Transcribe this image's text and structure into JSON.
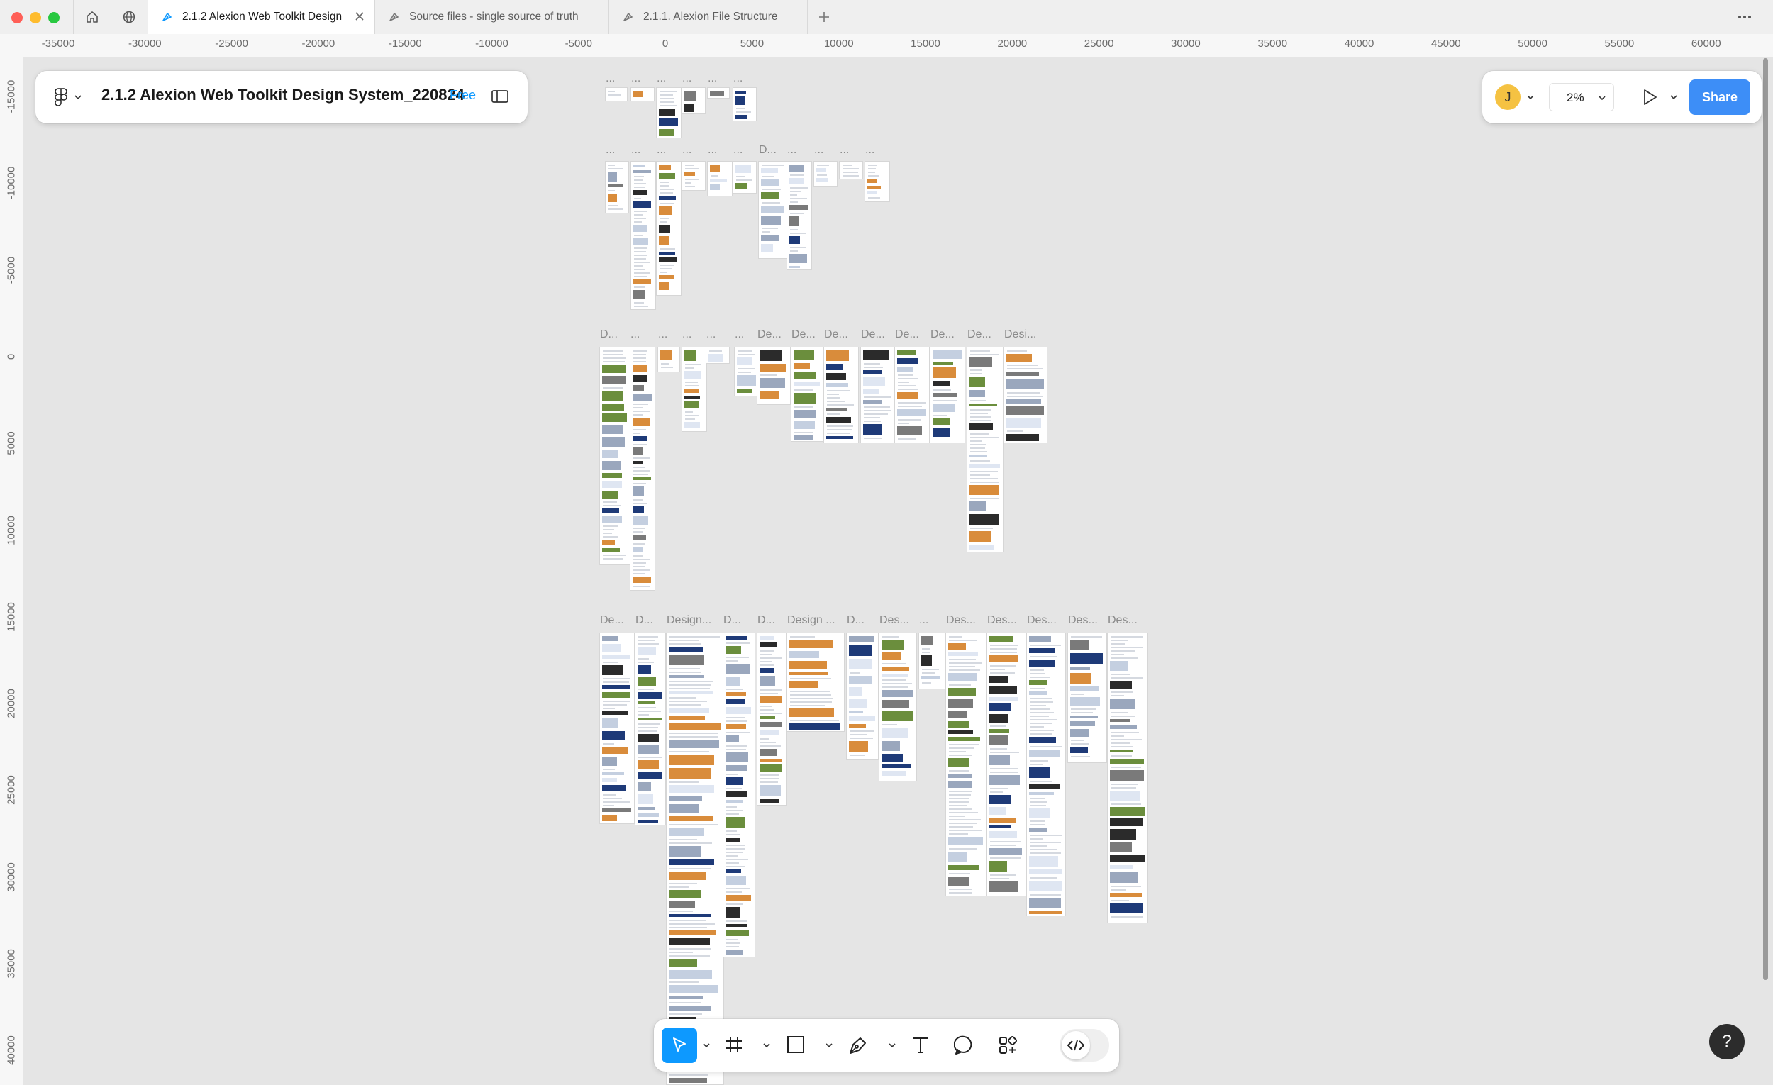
{
  "window": {
    "traffic_lights": [
      "#ff5f57",
      "#febc2e",
      "#28c840"
    ]
  },
  "tabs": [
    {
      "label": "2.1.2 Alexion Web Toolkit Design System_220824",
      "icon": "design-file-icon",
      "active": true
    },
    {
      "label": "Source files - single source of truth",
      "icon": "design-file-icon",
      "active": false
    },
    {
      "label": "2.1.1. Alexion File Structure",
      "icon": "design-file-icon",
      "active": false
    }
  ],
  "rulers": {
    "horizontal": [
      "-35000",
      "-30000",
      "-25000",
      "-20000",
      "-15000",
      "-10000",
      "-5000",
      "0",
      "5000",
      "10000",
      "15000",
      "20000",
      "25000",
      "30000",
      "35000",
      "40000",
      "45000",
      "50000",
      "55000",
      "60000"
    ],
    "vertical": [
      "-15000",
      "-10000",
      "-5000",
      "0",
      "5000",
      "10000",
      "15000",
      "20000",
      "25000",
      "30000",
      "35000",
      "40000"
    ]
  },
  "file": {
    "name": "2.1.2 Alexion Web Toolkit Design System_220824",
    "plan": "Free"
  },
  "right": {
    "avatar_initial": "J",
    "zoom": "2%",
    "share_label": "Share"
  },
  "frame_labels": {
    "row1": [
      "...",
      "...",
      "...",
      "...",
      "...",
      "..."
    ],
    "row2": [
      "...",
      "...",
      "...",
      "...",
      "...",
      "...",
      "D...",
      "...",
      "...",
      "...",
      "..."
    ],
    "row3": [
      "D...",
      "...",
      "...",
      "...",
      "...",
      "...",
      "De...",
      "De...",
      "De...",
      "De...",
      "De...",
      "De...",
      "De...",
      "Desi..."
    ],
    "row4": [
      "De...",
      "D...",
      "Design...",
      "D...",
      "D...",
      "Design ...",
      "D...",
      "Des...",
      "...",
      "Des...",
      "Des...",
      "Des...",
      "Des...",
      "Des..."
    ]
  },
  "toolbar": {
    "tools": [
      "move-tool",
      "frame-tool",
      "shape-tool",
      "pen-tool",
      "text-tool",
      "comment-tool",
      "actions-tool",
      "dev-mode-toggle"
    ]
  },
  "help_label": "?",
  "colors": {
    "accent": "#0d99ff",
    "share": "#3d8ef7",
    "navy": "#1e3a78",
    "avatar": "#f5c242"
  }
}
